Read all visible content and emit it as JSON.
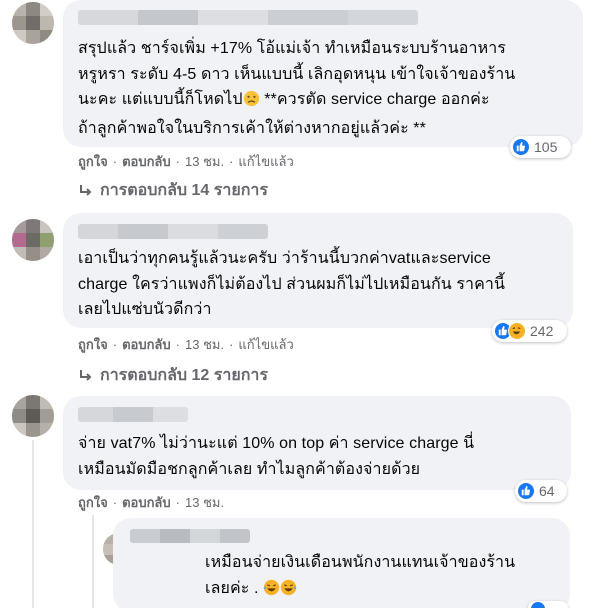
{
  "comments": [
    {
      "text": "สรุปแล้ว ชาร์จเพิ่ม +17% โอ้แม่เจ้า ทำเหมือนระบบร้านอาหาร\nหรูหรา ระดับ 4-5 ดาว เห็นแบบนี้ เลิกอุดหนุน เข้าใจเจ้าของร้าน\nนะคะ แต่แบบนี้ก็โหดไป",
      "text_tail": " **ควรตัด service charge ออกค่ะ\nถ้าลูกค้าพอใจในบริการเค้าให้ต่างหากอยู่แล้วค่ะ **",
      "reaction_count": "105",
      "like_label": "ถูกใจ",
      "reply_label": "ตอบกลับ",
      "time": "13 ชม.",
      "edited": "แก้ไขแล้ว",
      "replies_label": "การตอบกลับ 14 รายการ"
    },
    {
      "text": "เอาเป็นว่าทุกคนรู้แล้วนะครับ ว่าร้านนี้บวกค่าvatและservice\ncharge ใครว่าแพงก็ไม่ต้องไป ส่วนผมก็ไม่ไปเหมือนกัน ราคานี้\nเลยไปแซ่บนัวดีกว่า",
      "reaction_count": "242",
      "like_label": "ถูกใจ",
      "reply_label": "ตอบกลับ",
      "time": "13 ชม.",
      "edited": "แก้ไขแล้ว",
      "replies_label": "การตอบกลับ 12 รายการ"
    },
    {
      "text": "จ่าย vat7% ไม่ว่านะแต่ 10% on top ค่า service charge นี่\nเหมือนมัดมือชกลูกค้าเลย ทำไมลูกค้าต้องจ่ายด้วย",
      "reaction_count": "64",
      "like_label": "ถูกใจ",
      "reply_label": "ตอบกลับ",
      "time": "13 ชม."
    }
  ],
  "reply": {
    "text": "เหมือนจ่ายเงินเดือนพนักงานแทนเจ้าของร้าน\nเลยค่ะ ."
  },
  "colors": {
    "bubble": "#f0f2f5",
    "meta_text": "#65676b",
    "like_blue": "#1877f2",
    "haha_yellow": "#f7b125"
  },
  "icons": [
    "like-icon",
    "haha-icon",
    "reply-arrow-icon",
    "sad-face-emoji",
    "rofl-emoji"
  ]
}
